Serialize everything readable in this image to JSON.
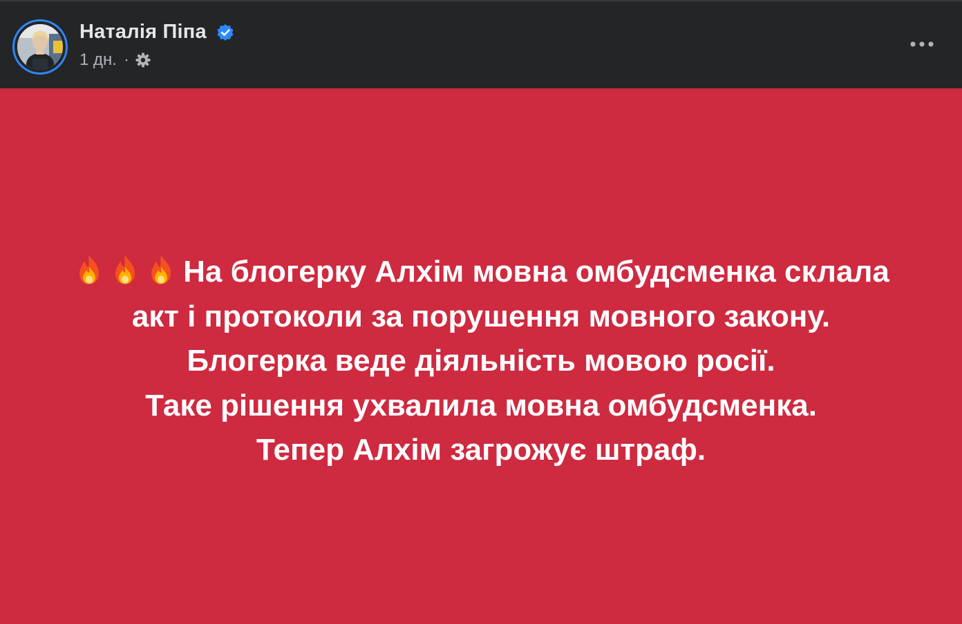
{
  "post": {
    "author": {
      "name": "Наталія Піпа",
      "verified": true,
      "avatar": "profile-photo"
    },
    "meta": {
      "timestamp": "1 дн.",
      "separator": "·",
      "privacy_icon": "gear-icon"
    },
    "more_icon": "more-dots-icon",
    "background_color": "#ce2a40",
    "text": {
      "emoji": [
        "fire-icon",
        "fire-icon",
        "fire-icon"
      ],
      "lines": [
        "На блогерку Алхім мовна омбудсменка склала",
        "акт і протоколи за порушення мовного закону.",
        "Блогерка веде діяльність мовою росії.",
        "Таке рішення ухвалила мовна омбудсменка.",
        "Тепер Алхім загрожує штраф."
      ]
    }
  }
}
